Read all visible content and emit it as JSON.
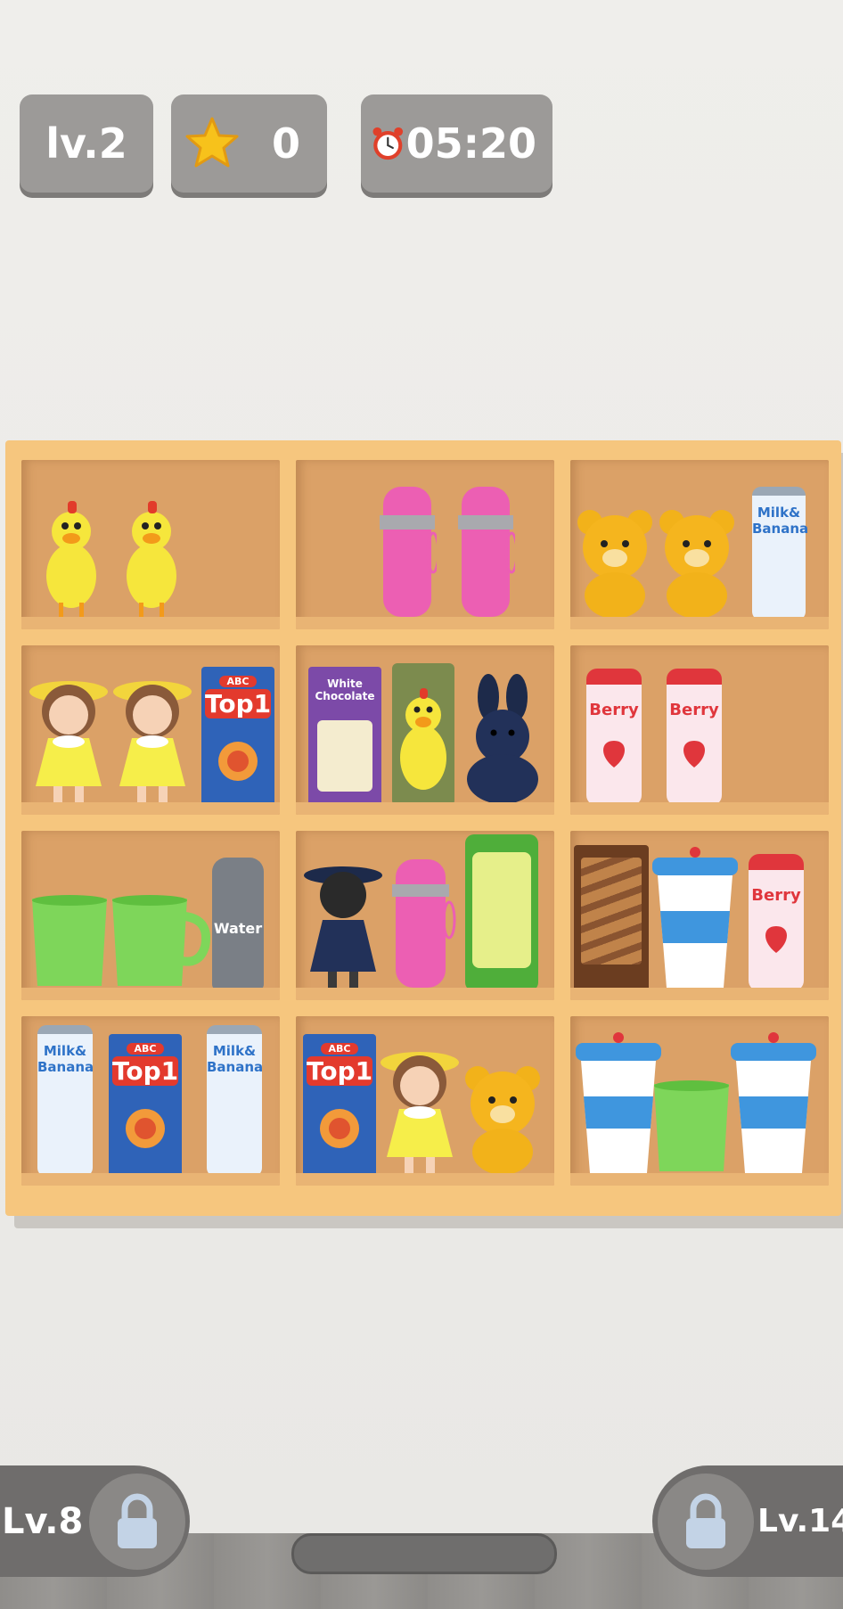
{
  "hud": {
    "level": "lv.2",
    "stars": "0",
    "timer": "05:20"
  },
  "shelf": {
    "rows": [
      [
        {
          "items": [
            "rubber-chicken",
            "rubber-chicken"
          ]
        },
        {
          "items": [
            "pink-thermos",
            "pink-thermos"
          ]
        },
        {
          "items": [
            "teddy-bear",
            "teddy-bear",
            "milk-banana-can"
          ]
        }
      ],
      [
        {
          "items": [
            "doll",
            "doll",
            "top1-cracker-box"
          ]
        },
        {
          "items": [
            "white-chocolate-box",
            "rubber-chicken",
            "navy-bunny"
          ]
        },
        {
          "items": [
            "strawberry-milk",
            "strawberry-milk"
          ]
        }
      ],
      [
        {
          "items": [
            "green-mug",
            "green-mug",
            "water-bottle"
          ]
        },
        {
          "items": [
            "dark-doll",
            "pink-thermos",
            "chips-can"
          ]
        },
        {
          "items": [
            "chocolate-wafer-box",
            "blue-coffee-cup",
            "strawberry-milk"
          ]
        }
      ],
      [
        {
          "items": [
            "milk-banana-can",
            "top1-cracker-box",
            "milk-banana-can"
          ]
        },
        {
          "items": [
            "top1-cracker-box",
            "doll",
            "teddy-bear"
          ]
        },
        {
          "items": [
            "blue-coffee-cup",
            "green-mug",
            "blue-coffee-cup"
          ]
        }
      ]
    ],
    "labels": {
      "top1": "Top1",
      "abc": "ABC",
      "water": "Water",
      "milk": "Milk&",
      "banana": "Banana",
      "berry": "Berry",
      "white_choc": "White Chocolate"
    }
  },
  "locks": {
    "left_label": "Lv.8",
    "right_label": "Lv.14"
  }
}
